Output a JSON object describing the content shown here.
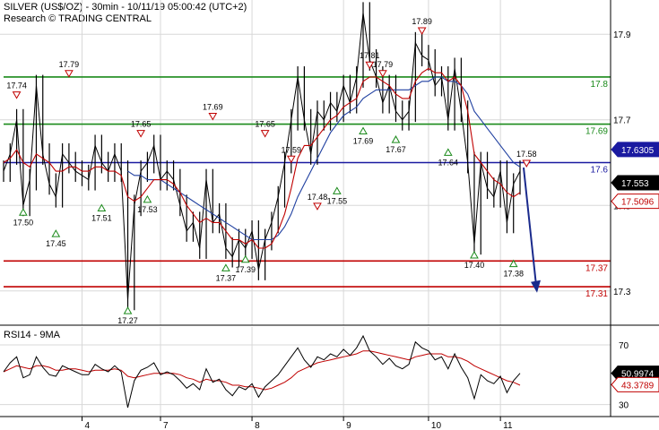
{
  "header": {
    "line1": "SILVER (US$/OZ) - 30min - 10/11/19 05:00:42 (UTC+2)",
    "line2": "Research © TRADING CENTRAL"
  },
  "rsi_panel": {
    "title": "RSI14 - 9MA"
  },
  "colors": {
    "price": "#000000",
    "ma_fast": "#c00000",
    "ma_slow": "#1f3fa0",
    "resistance": "#1a8a1a",
    "pivot": "#1a1aa0",
    "support": "#c00000",
    "grid": "#d8d8d8",
    "arrow": "#1a2a8c"
  },
  "chart_data": [
    {
      "type": "line",
      "panel": "price",
      "ylim": [
        17.22,
        17.98
      ],
      "y_ticks": [
        "17.9",
        "17.7",
        "17.5",
        "17.3"
      ],
      "x_session_labels": [
        "4",
        "7",
        "8",
        "9",
        "10",
        "11"
      ],
      "levels": [
        {
          "label": "17.8",
          "value": 17.8,
          "kind": "resistance"
        },
        {
          "label": "17.69",
          "value": 17.69,
          "kind": "resistance"
        },
        {
          "label": "17.6",
          "value": 17.6,
          "kind": "pivot"
        },
        {
          "label": "17.37",
          "value": 17.37,
          "kind": "support"
        },
        {
          "label": "17.31",
          "value": 17.31,
          "kind": "support"
        }
      ],
      "last_price_tags": [
        {
          "label": "17.6305",
          "value": 17.6305,
          "style": "blue"
        },
        {
          "label": "17.553",
          "value": 17.553,
          "style": "black"
        },
        {
          "label": "17.5096",
          "value": 17.5096,
          "style": "red"
        }
      ],
      "highs": [
        "17.74",
        "17.79",
        "17.65",
        "17.69",
        "17.65",
        "17.59",
        "17.48",
        "17.81",
        "17.79",
        "17.89",
        "17.58"
      ],
      "lows": [
        "17.50",
        "17.45",
        "17.51",
        "17.53",
        "17.27",
        "17.37",
        "17.39",
        "17.55",
        "17.69",
        "17.67",
        "17.64",
        "17.40",
        "17.38"
      ],
      "price": [
        17.58,
        17.62,
        17.7,
        17.5,
        17.56,
        17.78,
        17.62,
        17.55,
        17.52,
        17.62,
        17.6,
        17.58,
        17.57,
        17.56,
        17.64,
        17.6,
        17.58,
        17.62,
        17.58,
        17.28,
        17.5,
        17.58,
        17.6,
        17.64,
        17.56,
        17.58,
        17.56,
        17.5,
        17.44,
        17.46,
        17.4,
        17.56,
        17.46,
        17.48,
        17.4,
        17.38,
        17.42,
        17.4,
        17.44,
        17.35,
        17.42,
        17.46,
        17.52,
        17.6,
        17.7,
        17.8,
        17.7,
        17.62,
        17.72,
        17.7,
        17.74,
        17.72,
        17.78,
        17.74,
        17.8,
        17.95,
        17.84,
        17.8,
        17.74,
        17.78,
        17.72,
        17.7,
        17.72,
        17.88,
        17.85,
        17.84,
        17.78,
        17.8,
        17.7,
        17.82,
        17.72,
        17.6,
        17.41,
        17.6,
        17.54,
        17.52,
        17.58,
        17.46,
        17.55,
        17.58
      ],
      "ma_fast": [
        17.6,
        17.61,
        17.63,
        17.6,
        17.59,
        17.62,
        17.61,
        17.6,
        17.58,
        17.58,
        17.59,
        17.59,
        17.58,
        17.58,
        17.59,
        17.59,
        17.58,
        17.58,
        17.57,
        17.52,
        17.51,
        17.52,
        17.54,
        17.56,
        17.56,
        17.56,
        17.55,
        17.53,
        17.5,
        17.48,
        17.46,
        17.47,
        17.46,
        17.46,
        17.44,
        17.42,
        17.42,
        17.41,
        17.42,
        17.4,
        17.4,
        17.41,
        17.44,
        17.48,
        17.54,
        17.61,
        17.64,
        17.64,
        17.66,
        17.68,
        17.7,
        17.71,
        17.73,
        17.74,
        17.75,
        17.79,
        17.8,
        17.8,
        17.79,
        17.78,
        17.76,
        17.75,
        17.75,
        17.79,
        17.81,
        17.82,
        17.81,
        17.81,
        17.79,
        17.8,
        17.78,
        17.72,
        17.62,
        17.6,
        17.58,
        17.56,
        17.55,
        17.53,
        17.52,
        17.53
      ],
      "ma_slow": [
        null,
        null,
        null,
        null,
        null,
        null,
        null,
        null,
        null,
        null,
        null,
        null,
        null,
        null,
        null,
        null,
        null,
        null,
        null,
        17.58,
        17.57,
        17.57,
        17.56,
        17.56,
        17.56,
        17.55,
        17.54,
        17.53,
        17.52,
        17.51,
        17.5,
        17.49,
        17.48,
        17.47,
        17.46,
        17.45,
        17.44,
        17.43,
        17.42,
        17.42,
        17.42,
        17.42,
        17.43,
        17.45,
        17.48,
        17.52,
        17.55,
        17.58,
        17.61,
        17.64,
        17.67,
        17.69,
        17.71,
        17.72,
        17.73,
        17.75,
        17.76,
        17.77,
        17.77,
        17.77,
        17.77,
        17.77,
        17.77,
        17.78,
        17.79,
        17.79,
        17.8,
        17.8,
        17.79,
        17.79,
        17.78,
        17.76,
        17.72,
        17.7,
        17.68,
        17.66,
        17.64,
        17.62,
        17.6,
        17.59
      ]
    },
    {
      "type": "line",
      "panel": "rsi",
      "title": "RSI14 - 9MA",
      "ylim": [
        22,
        82
      ],
      "y_ticks": [
        "70",
        "30"
      ],
      "last_tags": [
        {
          "label": "50.9974",
          "value": 50.9974,
          "style": "black"
        },
        {
          "label": "43.3789",
          "value": 43.3789,
          "style": "red"
        }
      ],
      "rsi": [
        52,
        58,
        62,
        48,
        50,
        62,
        55,
        50,
        49,
        56,
        54,
        52,
        50,
        50,
        57,
        54,
        52,
        56,
        52,
        28,
        46,
        53,
        55,
        58,
        50,
        52,
        50,
        46,
        41,
        44,
        40,
        54,
        45,
        47,
        40,
        36,
        42,
        40,
        44,
        35,
        42,
        46,
        50,
        56,
        62,
        68,
        60,
        55,
        62,
        60,
        64,
        62,
        67,
        63,
        68,
        76,
        66,
        62,
        57,
        61,
        56,
        54,
        57,
        72,
        68,
        66,
        60,
        62,
        54,
        64,
        55,
        48,
        34,
        50,
        46,
        44,
        49,
        38,
        46,
        51
      ],
      "ma": [
        52,
        54,
        56,
        55,
        54,
        56,
        56,
        55,
        53,
        53,
        54,
        54,
        53,
        52,
        53,
        53,
        53,
        54,
        53,
        49,
        48,
        49,
        50,
        51,
        51,
        51,
        51,
        50,
        48,
        47,
        45,
        47,
        46,
        46,
        45,
        43,
        43,
        42,
        42,
        41,
        40,
        41,
        43,
        45,
        48,
        52,
        54,
        56,
        58,
        59,
        60,
        61,
        62,
        63,
        64,
        66,
        66,
        65,
        64,
        63,
        62,
        61,
        60,
        62,
        63,
        64,
        64,
        64,
        62,
        62,
        61,
        59,
        56,
        54,
        52,
        50,
        48,
        46,
        45,
        43
      ]
    }
  ]
}
